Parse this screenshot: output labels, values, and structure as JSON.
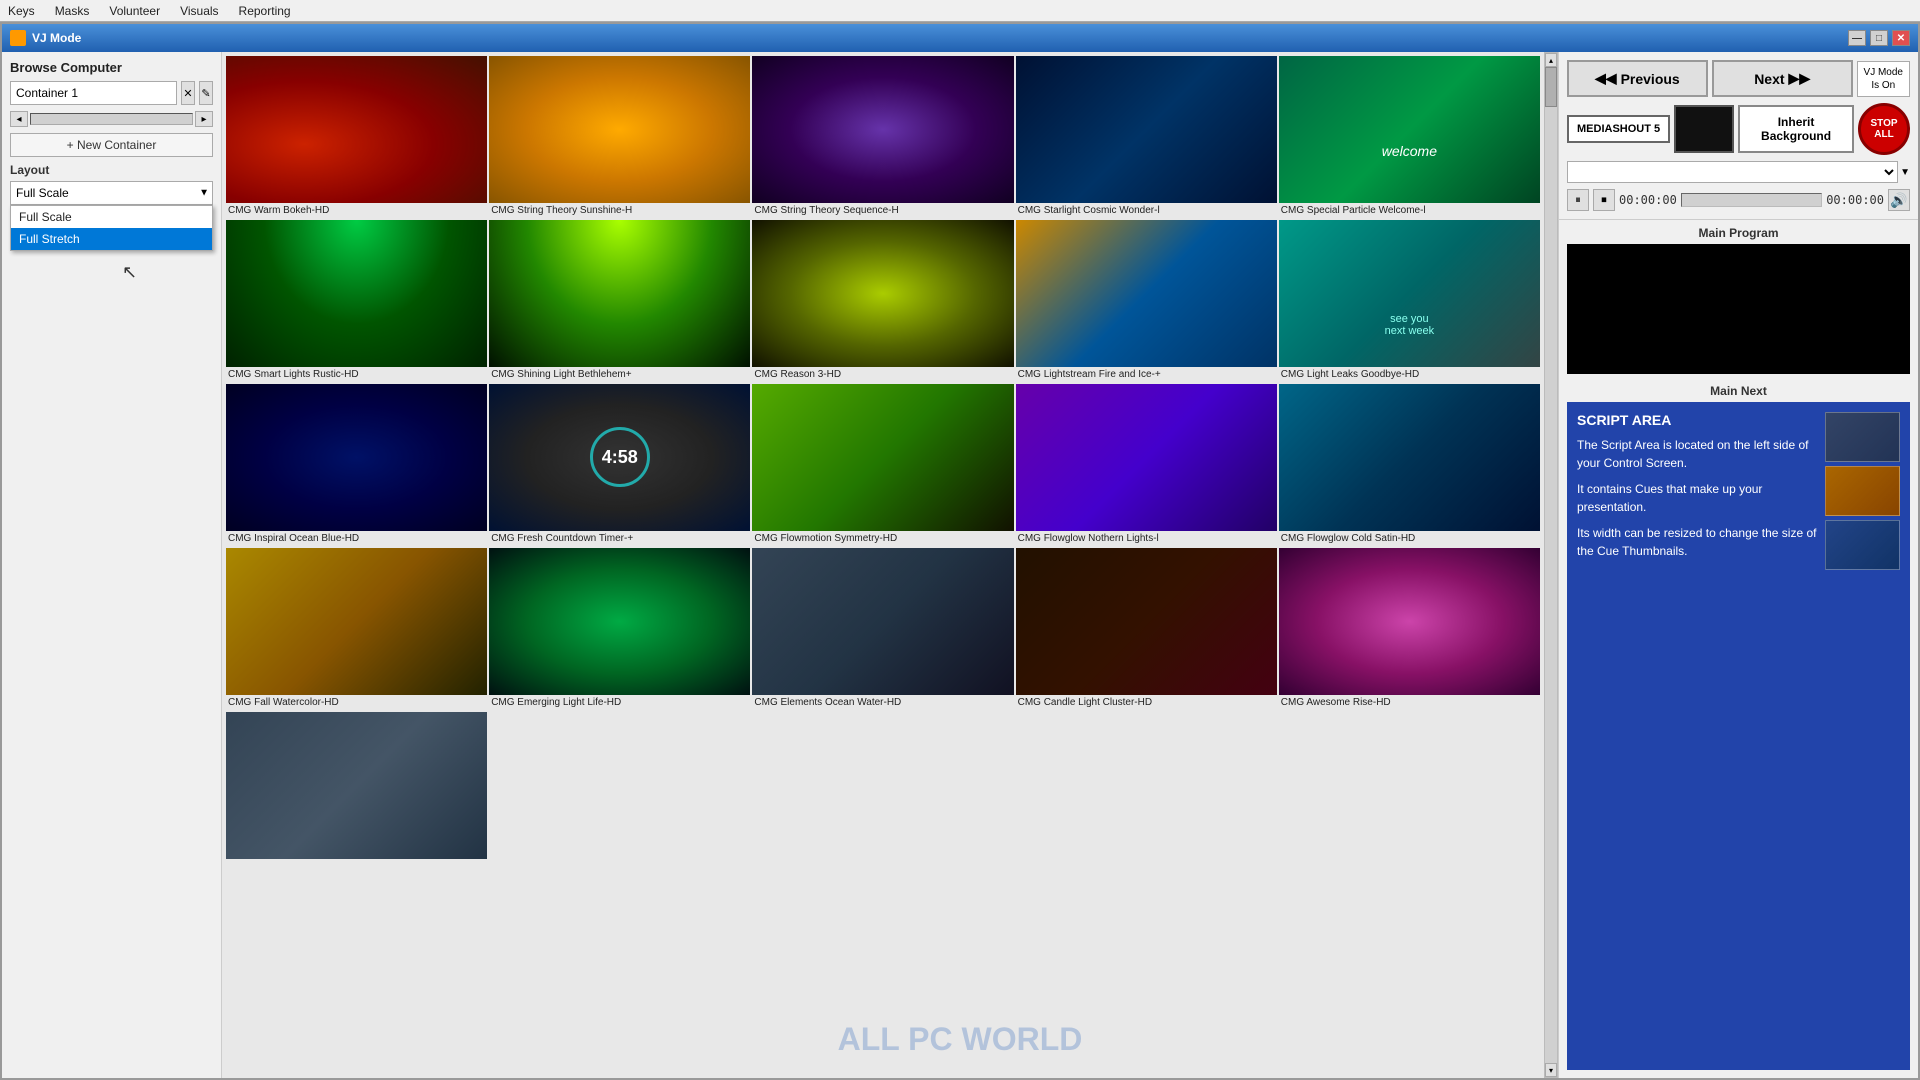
{
  "window": {
    "title": "VJ Mode",
    "menu_items": [
      "Keys",
      "Masks",
      "Volunteer",
      "Visuals",
      "Reporting"
    ]
  },
  "left_panel": {
    "browse_label": "Browse Computer",
    "container_value": "Container 1",
    "new_container_label": "+ New Container",
    "layout_label": "Layout",
    "layout_selected": "Full Scale",
    "layout_options": [
      "Full Scale",
      "Full Stretch"
    ]
  },
  "controls": {
    "previous_label": "◀◀ Previous",
    "next_label": "Next ▶▶",
    "vj_mode_label": "VJ Mode\nIs On",
    "mediashout_label": "MEDIASHOUT 5",
    "inherit_bg_label": "Inherit Background",
    "stop_all_label": "STOP ALL",
    "time_start": "00:00:00",
    "time_end": "00:00:00",
    "main_program_label": "Main Program",
    "main_next_label": "Main Next"
  },
  "script": {
    "title": "SCRIPT AREA",
    "para1": "The Script Area is located on the left side of your Control Screen.",
    "para2": "It contains Cues that make up your presentation.",
    "para3": "Its width can be resized to change the size of the Cue Thumbnails."
  },
  "media_items": [
    {
      "label": "CMG Warm Bokeh-HD",
      "thumb_class": "thumb-warm-bokeh"
    },
    {
      "label": "CMG String Theory Sunshine-H",
      "thumb_class": "thumb-string-sunshine"
    },
    {
      "label": "CMG String Theory Sequence-H",
      "thumb_class": "thumb-string-sequence"
    },
    {
      "label": "CMG Starlight Cosmic Wonder-l",
      "thumb_class": "thumb-starlight"
    },
    {
      "label": "CMG Special Particle Welcome-l",
      "thumb_class": "thumb-special-welcome",
      "overlay": "welcome"
    },
    {
      "label": "CMG Smart Lights Rustic-HD",
      "thumb_class": "thumb-smart-lights"
    },
    {
      "label": "CMG Shining Light Bethlehem+",
      "thumb_class": "thumb-shining-bethlehem"
    },
    {
      "label": "CMG Reason 3-HD",
      "thumb_class": "thumb-reason"
    },
    {
      "label": "CMG Lightstream Fire and Ice-+",
      "thumb_class": "thumb-lightstream"
    },
    {
      "label": "CMG Light Leaks Goodbye-HD",
      "thumb_class": "thumb-light-leaks",
      "overlay": "see-you"
    },
    {
      "label": "CMG Inspiral Ocean Blue-HD",
      "thumb_class": "thumb-inspiral-ocean"
    },
    {
      "label": "CMG Fresh Countdown Timer-+",
      "thumb_class": "thumb-countdown",
      "overlay": "countdown"
    },
    {
      "label": "CMG Flowmotion Symmetry-HD",
      "thumb_class": "thumb-flowmotion-sym"
    },
    {
      "label": "CMG Flowglow Nothern Lights-l",
      "thumb_class": "thumb-flowglow-northern"
    },
    {
      "label": "CMG Flowglow Cold Satin-HD",
      "thumb_class": "thumb-flowglow-cold"
    },
    {
      "label": "CMG Fall Watercolor-HD",
      "thumb_class": "thumb-fall-watercolor"
    },
    {
      "label": "CMG Emerging Light Life-HD",
      "thumb_class": "thumb-emerging-light"
    },
    {
      "label": "CMG Elements Ocean Water-HD",
      "thumb_class": "thumb-elements-ocean"
    },
    {
      "label": "CMG Candle Light Cluster-HD",
      "thumb_class": "thumb-candle-light"
    },
    {
      "label": "CMG Awesome Rise-HD",
      "thumb_class": "thumb-awesome-rise"
    },
    {
      "label": "",
      "thumb_class": "thumb-last"
    }
  ],
  "watermark": "ALL PC WORLD"
}
